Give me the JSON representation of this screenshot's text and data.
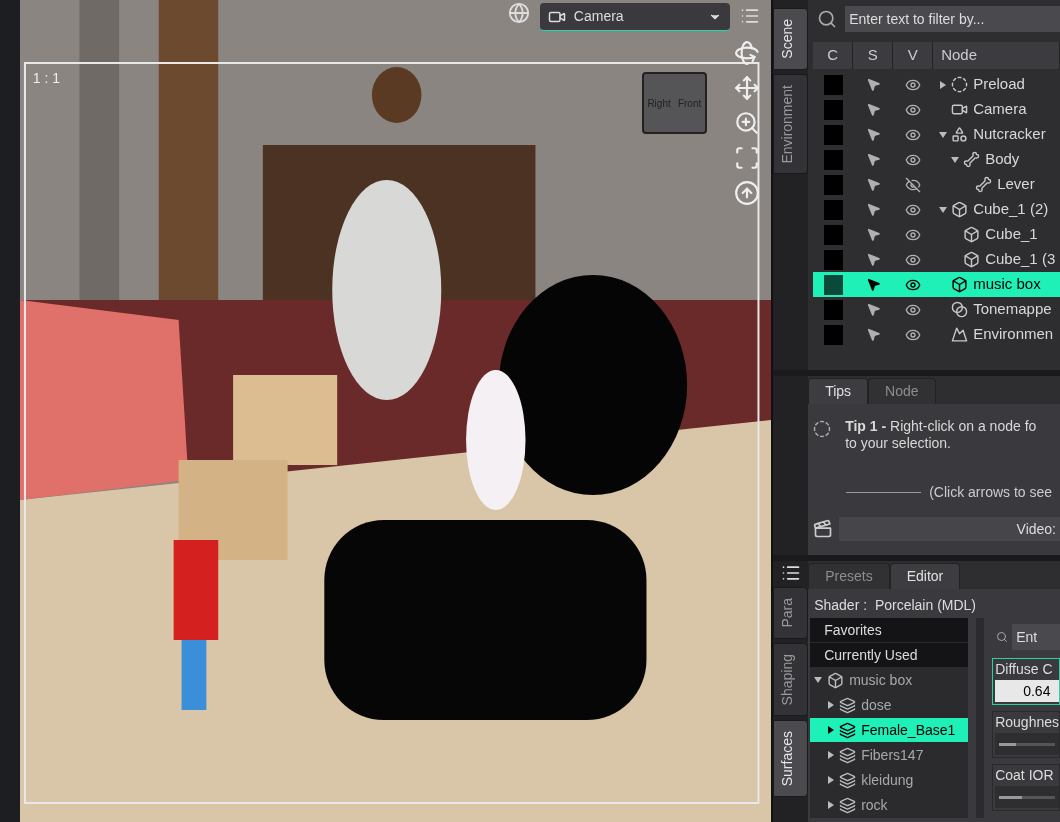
{
  "viewport": {
    "ratio": "1 : 1",
    "camera": "Camera",
    "cube_labels": [
      "Right",
      "Front"
    ]
  },
  "scene_tabs": [
    {
      "label": "Scene",
      "selected": true
    },
    {
      "label": "Environment",
      "selected": false
    }
  ],
  "scene": {
    "filter_placeholder": "Enter text to filter by...",
    "columns": [
      "C",
      "S",
      "V",
      "Node"
    ],
    "nodes": [
      {
        "name": "Preload",
        "kind": "group",
        "expanded": false,
        "visible": true,
        "selected": false
      },
      {
        "name": "Camera",
        "kind": "camera",
        "visible": true,
        "selected": false
      },
      {
        "name": "Nutcracker",
        "kind": "figure",
        "expanded": true,
        "visible": true,
        "selected": false,
        "children": [
          {
            "name": "Body",
            "kind": "bone",
            "expanded": true,
            "visible": true,
            "selected": false,
            "children": [
              {
                "name": "Lever",
                "kind": "bone",
                "visible": false,
                "selected": false
              }
            ]
          }
        ]
      },
      {
        "name": "Cube_1 (2)",
        "kind": "prop",
        "expanded": true,
        "visible": true,
        "selected": false,
        "children": [
          {
            "name": "Cube_1",
            "kind": "prop",
            "visible": true,
            "selected": false
          },
          {
            "name": "Cube_1 (3",
            "kind": "prop",
            "visible": true,
            "selected": false
          }
        ]
      },
      {
        "name": "music box",
        "kind": "prop",
        "visible": true,
        "selected": true
      },
      {
        "name": "Tonemappe",
        "kind": "tonemapper",
        "visible": true,
        "selected": false
      },
      {
        "name": "Environmen",
        "kind": "environment",
        "visible": true,
        "selected": false
      }
    ]
  },
  "tips_tabs": [
    {
      "label": "Tips",
      "selected": true
    },
    {
      "label": "Node",
      "selected": false
    }
  ],
  "tip": {
    "lines": [
      "**Tip 1 -** Right-click on a node fo",
      "to your selection."
    ],
    "hint": "(Click arrows to see",
    "video": "Video:"
  },
  "surface_side_tabs": [
    {
      "label": "Para",
      "selected": false
    },
    {
      "label": "Shaping",
      "selected": false
    },
    {
      "label": "Surfaces",
      "selected": true
    }
  ],
  "surface_tabs": [
    {
      "label": "Presets",
      "selected": false
    },
    {
      "label": "Editor",
      "selected": true
    }
  ],
  "shader": "Shader :  Porcelain (MDL)",
  "surface_groups": [
    "Favorites",
    "Currently Used"
  ],
  "surface_tree": [
    {
      "name": "music box",
      "expanded": true,
      "selected": false,
      "children": [
        {
          "name": "dose",
          "expanded": false,
          "selected": false
        },
        {
          "name": "Female_Base1",
          "expanded": false,
          "selected": true
        },
        {
          "name": "Fibers147",
          "expanded": false,
          "selected": false
        },
        {
          "name": "kleidung",
          "expanded": false,
          "selected": false
        },
        {
          "name": "rock",
          "expanded": false,
          "selected": false
        }
      ]
    }
  ],
  "property_filter_placeholder": "Ent",
  "properties": [
    {
      "kind": "field",
      "label": "Diffuse C",
      "value": "0.64",
      "selected": true
    },
    {
      "kind": "slider",
      "label": "Roughnes",
      "level": 0.3,
      "selected": false
    },
    {
      "kind": "slider",
      "label": "Coat IOR",
      "level": 0.4,
      "selected": false
    }
  ]
}
